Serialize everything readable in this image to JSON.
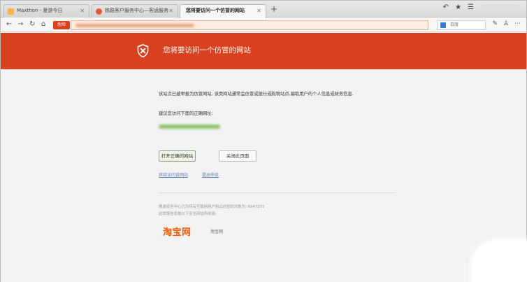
{
  "tabs": [
    {
      "title": "Maxthon - 爱游今日",
      "favicon_color": "#f4b942"
    },
    {
      "title": "铁路客户服务中心—客运服务",
      "favicon_color": "#e45b3c"
    },
    {
      "title": "您将要访问一个仿冒的网站",
      "favicon_color": "#f7f7f7"
    }
  ],
  "toolbar": {
    "danger_badge": "危险",
    "search_placeholder": "百度"
  },
  "banner": {
    "title": "您将要访问一个仿冒的网站",
    "color": "#d9411e"
  },
  "warning": {
    "message": "该站点已被举报为仿冒网站, 该类网站通常会仿冒或银行或购物站点,骗取用户的个人信息或财务信息.",
    "suggest_label": "建议您访问下面的正确网址:",
    "open_button": "打开正确的网站",
    "close_button": "关闭此页面",
    "link_continue": "继续访问该网站",
    "link_report": "提出申诉"
  },
  "footer": {
    "line1": "傲游安全中心已为所有互联网用户阻止仿冒的次数为: 6947375",
    "line2": "此举报信息被以下安全网站所收录:",
    "partner_logo": "淘宝网",
    "partner_label": "淘宝网"
  }
}
